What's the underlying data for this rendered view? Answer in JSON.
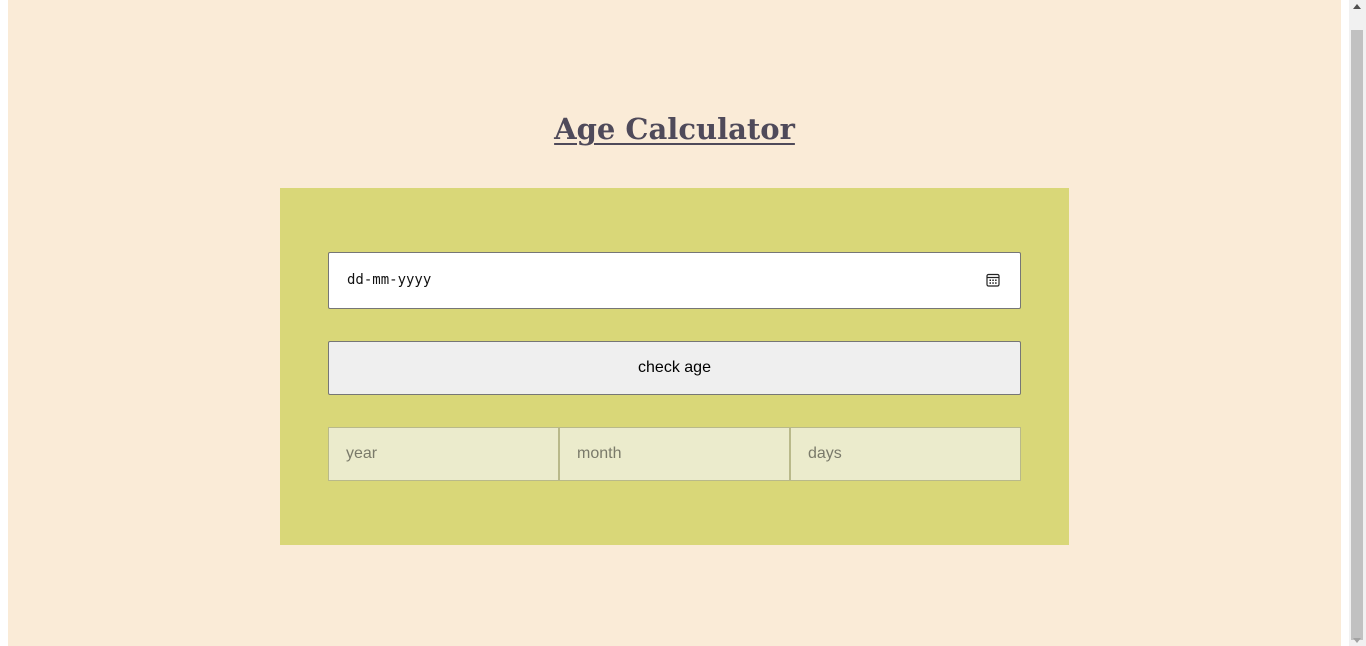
{
  "title": "Age Calculator",
  "date_input": {
    "placeholder": "dd-mm-yyyy",
    "icon": "calendar-icon"
  },
  "check_button": {
    "label": "check age"
  },
  "results": {
    "year_placeholder": "year",
    "month_placeholder": "month",
    "days_placeholder": "days"
  },
  "colors": {
    "page_background": "#faebd7",
    "card_background": "#d9d778",
    "title_color": "#4f4a5a",
    "result_field_background": "#ebebcc"
  }
}
